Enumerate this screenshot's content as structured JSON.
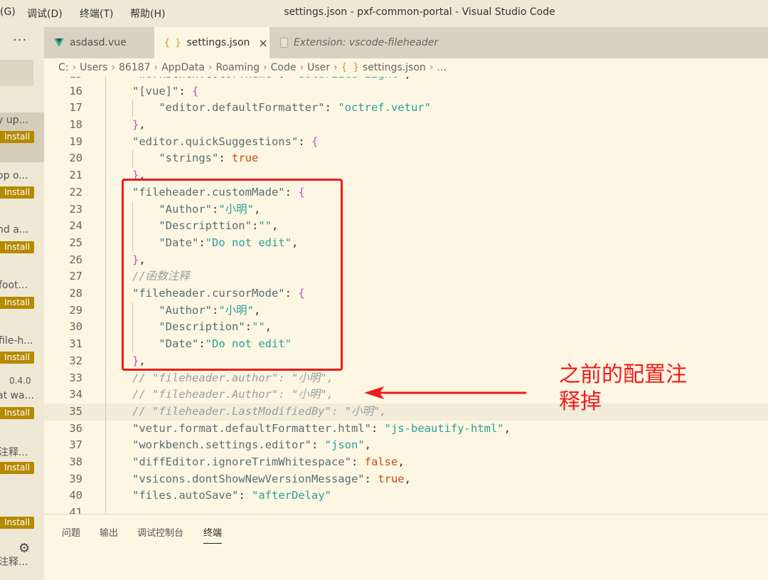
{
  "window": {
    "title": "settings.json - pxf-common-portal - Visual Studio Code",
    "menus": [
      "(G)",
      "调试(D)",
      "终端(T)",
      "帮助(H)"
    ]
  },
  "sidebar": {
    "more_label": "···",
    "items": [
      {
        "text": "y up...",
        "install": "Install"
      },
      {
        "text": "op o...",
        "install": "Install"
      },
      {
        "text": "nd a...",
        "install": "Install"
      },
      {
        "text": "foot...",
        "install": "Install"
      },
      {
        "text": "file-h...",
        "install": "Install"
      },
      {
        "text": "at wa...",
        "install": "Install",
        "version": "0.4.0"
      },
      {
        "text": "注释...",
        "install": "Install"
      },
      {
        "text": "",
        "install": "Install"
      },
      {
        "text": "注释..."
      }
    ]
  },
  "tabs": [
    {
      "label": "asdasd.vue",
      "icon": "vue-icon"
    },
    {
      "label": "settings.json",
      "icon": "json-icon",
      "close": "×"
    },
    {
      "label": "Extension: vscode-fileheader",
      "icon": "file-icon"
    }
  ],
  "breadcrumb": {
    "segments": [
      "C:",
      "Users",
      "86187",
      "AppData",
      "Roaming",
      "Code",
      "User",
      "settings.json",
      "..."
    ],
    "json_icon": "{ }"
  },
  "editor": {
    "lines": [
      {
        "n": "15",
        "text": "\"workbench.colorTheme\": \"Solarized Light\","
      },
      {
        "n": "16",
        "text": "\"[vue]\": {"
      },
      {
        "n": "17",
        "text": "    \"editor.defaultFormatter\": \"octref.vetur\""
      },
      {
        "n": "18",
        "text": "},"
      },
      {
        "n": "19",
        "text": "\"editor.quickSuggestions\": {"
      },
      {
        "n": "20",
        "text": "    \"strings\": true"
      },
      {
        "n": "21",
        "text": "},"
      },
      {
        "n": "22",
        "text": "\"fileheader.customMade\": {"
      },
      {
        "n": "23",
        "text": "    \"Author\":\"小明\","
      },
      {
        "n": "24",
        "text": "    \"Descripttion\":\"\","
      },
      {
        "n": "25",
        "text": "    \"Date\":\"Do not edit\","
      },
      {
        "n": "26",
        "text": "},"
      },
      {
        "n": "27",
        "text": "//函数注释"
      },
      {
        "n": "28",
        "text": "\"fileheader.cursorMode\": {"
      },
      {
        "n": "29",
        "text": "    \"Author\":\"小明\","
      },
      {
        "n": "30",
        "text": "    \"Description\":\"\","
      },
      {
        "n": "31",
        "text": "    \"Date\":\"Do not edit\""
      },
      {
        "n": "32",
        "text": "},"
      },
      {
        "n": "33",
        "text": "// \"fileheader.author\": \"小明\","
      },
      {
        "n": "34",
        "text": "// \"fileheader.Author\": \"小明\","
      },
      {
        "n": "35",
        "text": "// \"fileheader.LastModifiedBy\": \"小明\","
      },
      {
        "n": "36",
        "text": "\"vetur.format.defaultFormatter.html\": \"js-beautify-html\","
      },
      {
        "n": "37",
        "text": "\"workbench.settings.editor\": \"json\","
      },
      {
        "n": "38",
        "text": "\"diffEditor.ignoreTrimWhitespace\": false,"
      },
      {
        "n": "39",
        "text": "\"vsicons.dontShowNewVersionMessage\": true,"
      },
      {
        "n": "40",
        "text": "\"files.autoSave\": \"afterDelay\""
      },
      {
        "n": "41",
        "text": ""
      }
    ]
  },
  "panel": {
    "tabs": [
      "问题",
      "输出",
      "调试控制台",
      "终端"
    ],
    "active": "终端"
  },
  "annotation": {
    "line1": "之前的配置注",
    "line2": "释掉",
    "color": "#f21a1a"
  },
  "colors": {
    "background": "#fdf6e3",
    "key": "#586e75",
    "string": "#2aa198",
    "boolean": "#cb4b16",
    "brace": "#c04ec0",
    "comment": "#93a1a1",
    "install_badge": "#b58900"
  }
}
